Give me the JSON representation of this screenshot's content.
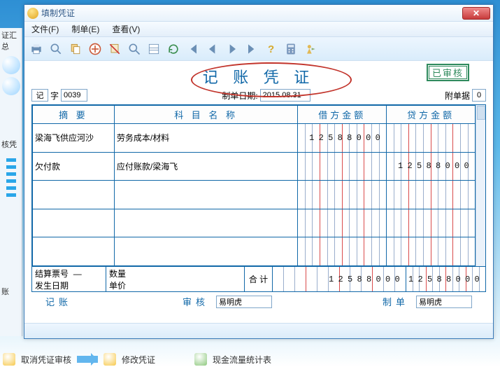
{
  "left_panel": {
    "frag1": "证汇总",
    "frag2": "账",
    "frag3": "核凭"
  },
  "window": {
    "title": "填制凭证"
  },
  "menus": {
    "file": "文件(F)",
    "make": "制单(E)",
    "view": "查看(V)"
  },
  "toolbar_icons": [
    "print-icon",
    "preview-icon",
    "copy-icon",
    "add-icon",
    "delete-icon",
    "find-icon",
    "list-icon",
    "refresh-icon",
    "first-icon",
    "prev-icon",
    "next-icon",
    "last-icon",
    "help-icon",
    "calc-icon",
    "exit-icon"
  ],
  "doc": {
    "title": "记 账 凭 证",
    "stamp": "已审核",
    "word_label": "字",
    "word": "记",
    "number": "0039",
    "date_label": "制单日期:",
    "date": "2015.08.31",
    "attach_label": "附单据",
    "attach": "0"
  },
  "grid": {
    "headers": {
      "summary": "摘  要",
      "subject": "科 目 名 称",
      "debit": "借方金额",
      "credit": "贷方金额"
    },
    "rows": [
      {
        "summary": "梁海飞供应河沙",
        "subject": "劳务成本/材料",
        "debit": "12588000",
        "credit": ""
      },
      {
        "summary": "欠付款",
        "subject": "应付账款/梁海飞",
        "debit": "",
        "credit": "12588000"
      },
      {
        "summary": "",
        "subject": "",
        "debit": "",
        "credit": ""
      },
      {
        "summary": "",
        "subject": "",
        "debit": "",
        "credit": ""
      },
      {
        "summary": "",
        "subject": "",
        "debit": "",
        "credit": ""
      }
    ]
  },
  "bottom": {
    "settle_no_label": "结算票号",
    "settle_no": "—",
    "occur_date_label": "发生日期",
    "qty_label": "数量",
    "price_label": "单价",
    "heji": "合  计",
    "debit_total": "12588000",
    "credit_total": "12588000"
  },
  "footer": {
    "book_label": "记账",
    "audit_label": "审核",
    "auditor": "易明虎",
    "maker_label": "制单",
    "maker": "易明虎"
  },
  "tasks": {
    "t1": "取消凭证审核",
    "t2": "修改凭证",
    "t3": "现金流量统计表"
  }
}
